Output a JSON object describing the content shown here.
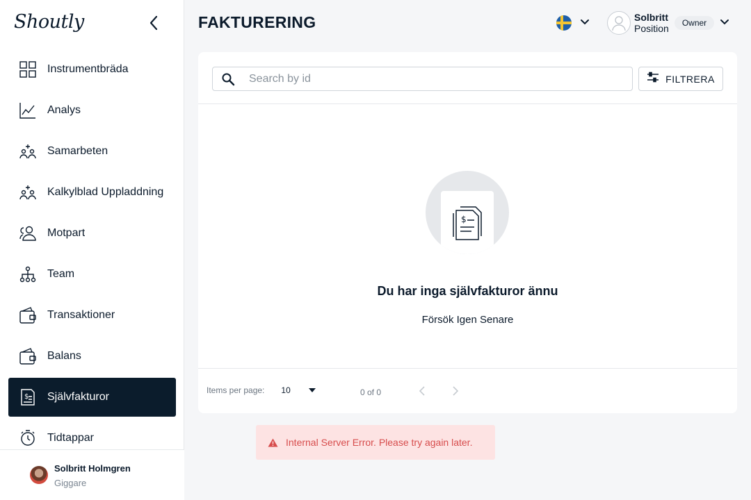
{
  "sidebar": {
    "logo": "Shoutly",
    "items": [
      {
        "label": "Instrumentbräda",
        "icon": "dashboard-grid-icon"
      },
      {
        "label": "Analys",
        "icon": "line-chart-icon"
      },
      {
        "label": "Samarbeten",
        "icon": "people-add-icon"
      },
      {
        "label": "Kalkylblad Uppladdning",
        "icon": "people-add-icon"
      },
      {
        "label": "Motpart",
        "icon": "users-icon"
      },
      {
        "label": "Team",
        "icon": "org-tree-icon"
      },
      {
        "label": "Transaktioner",
        "icon": "wallet-icon"
      },
      {
        "label": "Balans",
        "icon": "wallet-icon"
      },
      {
        "label": "Självfakturor",
        "icon": "invoice-icon",
        "active": true
      },
      {
        "label": "Tidtappar",
        "icon": "stopwatch-icon"
      }
    ],
    "footer": {
      "name": "Solbritt Holmgren",
      "role": "Giggare"
    }
  },
  "header": {
    "title": "FAKTURERING",
    "language_flag": "swedish-flag",
    "profile": {
      "name": "Solbritt",
      "position": "Position",
      "role_badge": "Owner"
    }
  },
  "main": {
    "search": {
      "placeholder": "Search by id",
      "value": ""
    },
    "filter_label": "FILTRERA",
    "empty_state": {
      "title": "Du har inga självfakturor ännu",
      "subtitle": "Försök Igen Senare",
      "icon": "invoice-document-icon"
    },
    "pagination": {
      "items_per_page_label": "Items per page:",
      "items_per_page_value": "10",
      "range": "0 of 0"
    }
  },
  "error": {
    "message": "Internal Server Error. Please try again later."
  },
  "colors": {
    "active_nav_bg": "#0b1c2c",
    "error_bg": "#fde3e3",
    "error_text": "#d74c4c"
  }
}
